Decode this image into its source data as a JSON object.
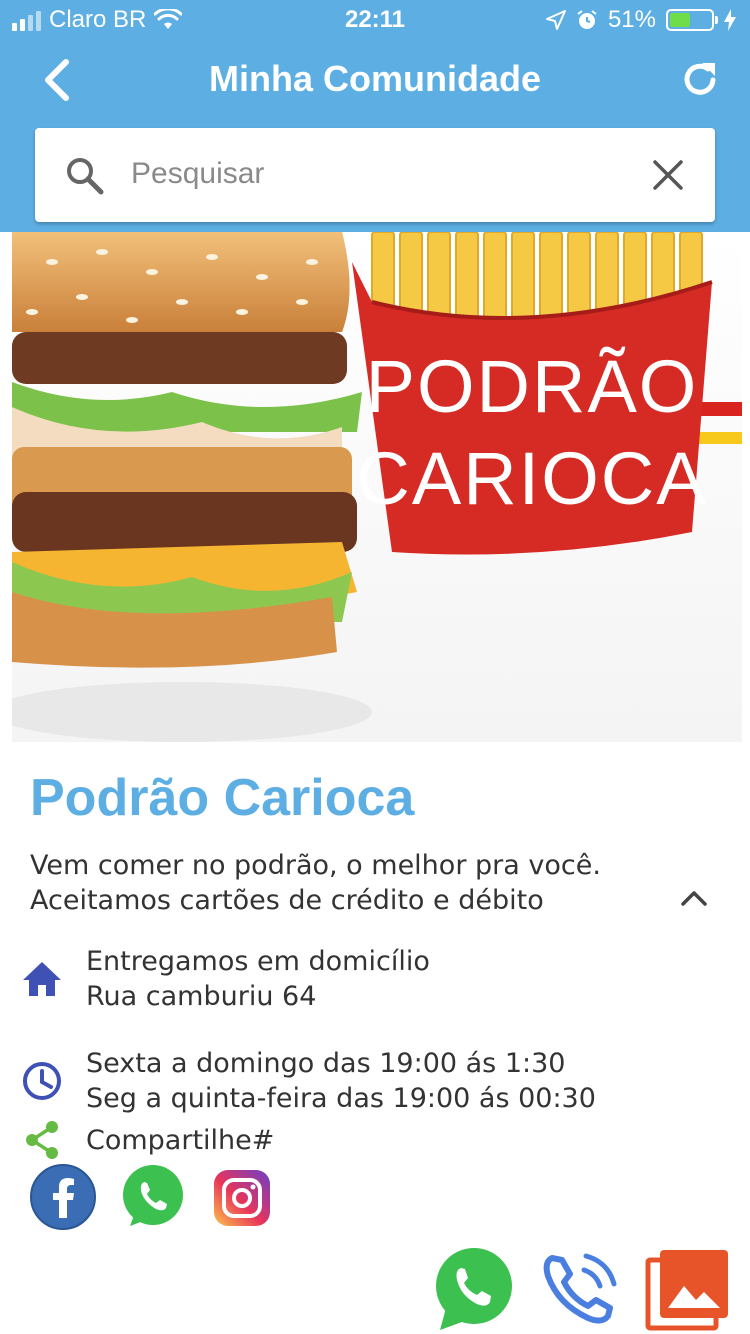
{
  "status_bar": {
    "carrier": "Claro BR",
    "time": "22:11",
    "battery": "51%"
  },
  "nav": {
    "title": "Minha Comunidade"
  },
  "search": {
    "placeholder": "Pesquisar",
    "value": ""
  },
  "hero": {
    "sign_line1": "PODRÃO",
    "sign_line2": "CARIOCA"
  },
  "business": {
    "name": "Podrão Carioca",
    "description_line1": "Vem comer no podrão, o melhor pra você.",
    "description_line2": "Aceitamos cartões de crédito e débito",
    "delivery": "Entregamos em domicílio",
    "address": "Rua camburiu 64",
    "hours_line1": "Sexta a domingo das 19:00 ás 1:30",
    "hours_line2": "Seg a quinta-feira das 19:00 ás 00:30",
    "share_label": "Compartilhe#"
  },
  "colors": {
    "header": "#5daee3",
    "title": "#5daee3",
    "home_icon": "#3f51b5",
    "clock_icon": "#3f51b5",
    "share_icon": "#66bb44",
    "facebook": "#3b6db5",
    "whatsapp": "#3cc04f",
    "phone": "#4a7fe0",
    "gallery": "#e8542a"
  },
  "icons": {
    "back": "chevron-left-icon",
    "refresh": "refresh-icon",
    "search": "search-icon",
    "clear": "close-icon",
    "collapse": "chevron-up-icon",
    "home": "home-icon",
    "clock": "clock-icon",
    "share": "share-icon"
  }
}
